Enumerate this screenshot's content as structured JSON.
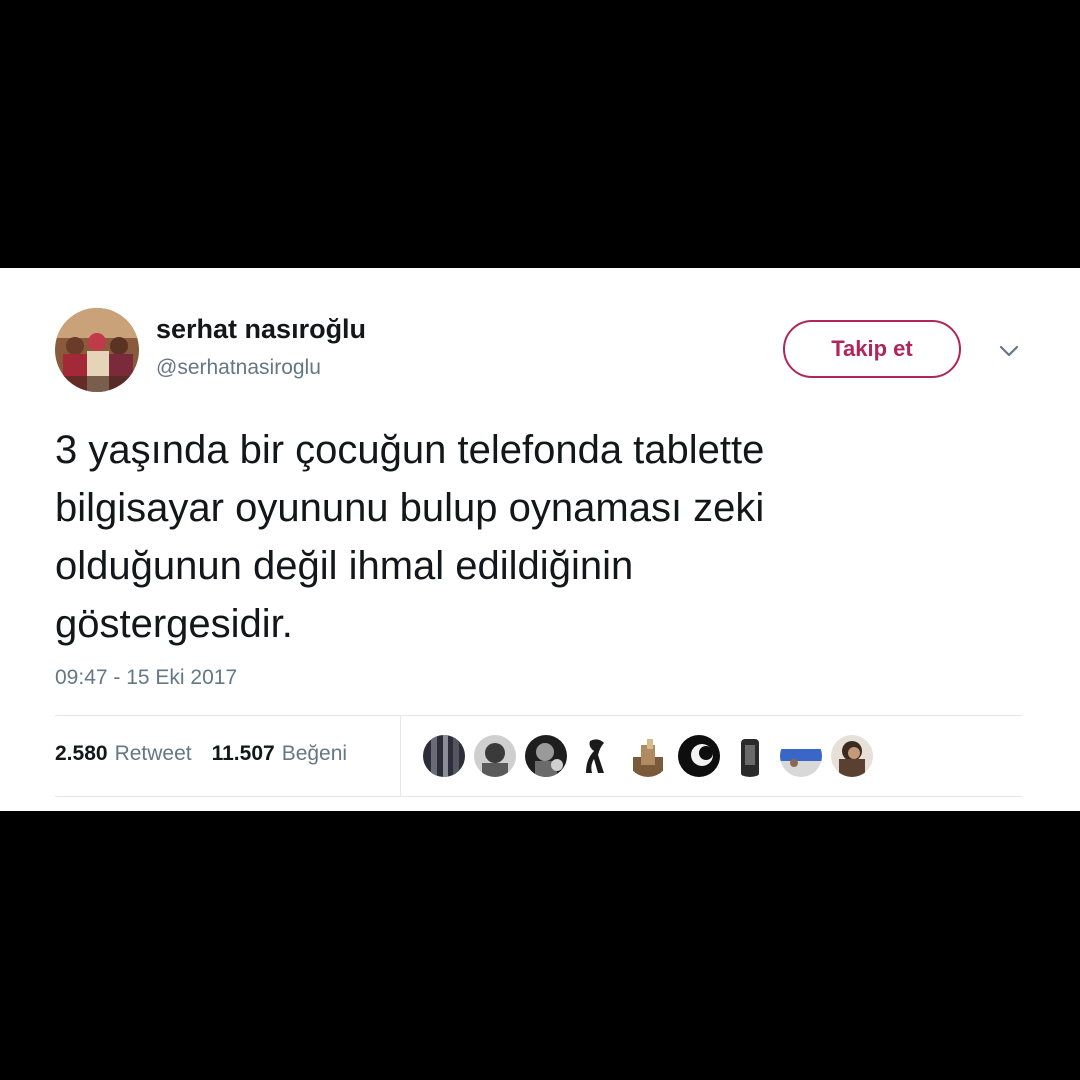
{
  "tweet": {
    "author": {
      "display_name": "serhat nasıroğlu",
      "handle": "@serhatnasiroglu",
      "avatar_icon": "profile-photo"
    },
    "follow_label": "Takip et",
    "menu_icon": "chevron-down-icon",
    "text": "3 yaşında bir çocuğun telefonda tablette\nbilgisayar oyununu bulup oynaması zeki\nolduğunun değil ihmal edildiğinin\ngöstergesidir.",
    "timestamp": "09:47 - 15 Eki 2017",
    "stats": {
      "retweet_count": "2.580",
      "retweet_label": "Retweet",
      "like_count": "11.507",
      "like_label": "Beğeni"
    },
    "likers_count_shown": 9
  },
  "colors": {
    "accent": "#b0255a",
    "text_primary": "#14171a",
    "text_secondary": "#657786",
    "divider": "#e1e8ed",
    "background": "#000000"
  }
}
